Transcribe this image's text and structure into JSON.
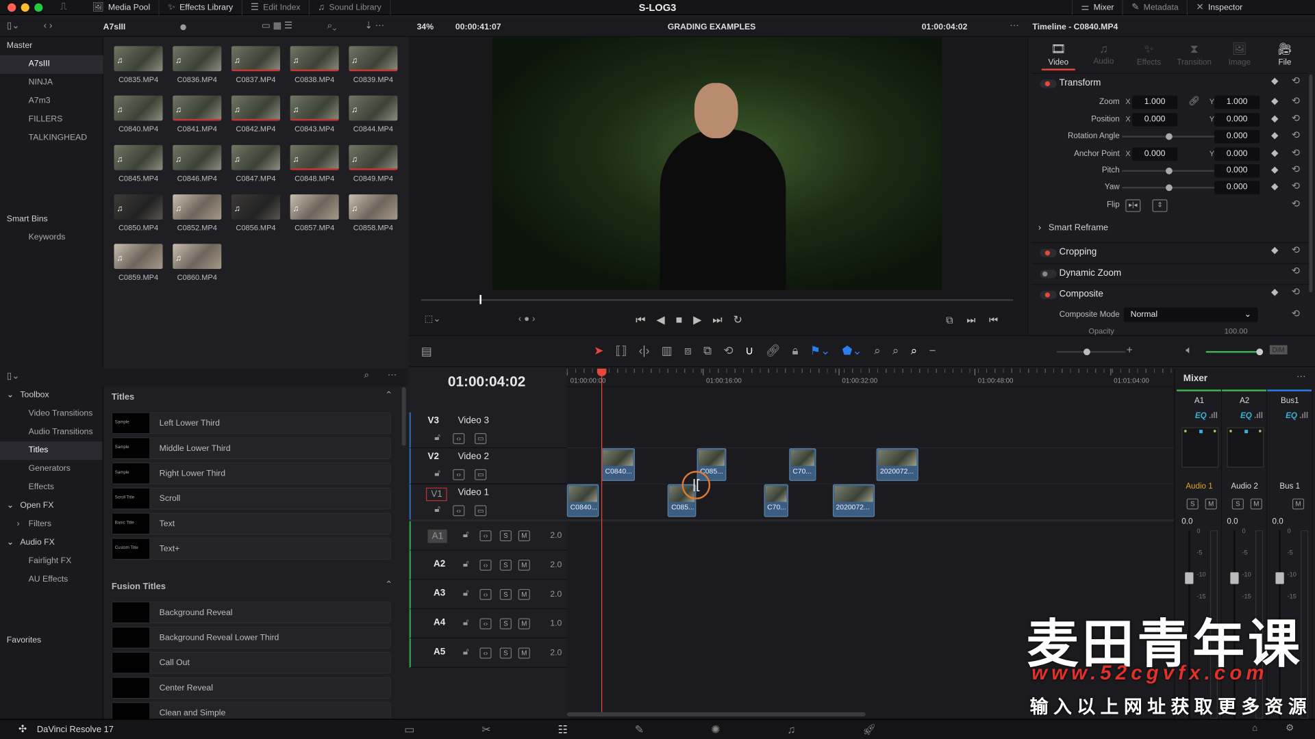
{
  "topbar": {
    "tabs": [
      {
        "label": "Media Pool",
        "icon": "media-pool-icon"
      },
      {
        "label": "Effects Library",
        "icon": "wand-icon"
      },
      {
        "label": "Edit Index",
        "icon": "list-icon"
      },
      {
        "label": "Sound Library",
        "icon": "music-list-icon"
      }
    ],
    "project_title": "S-LOG3",
    "right_tabs": [
      {
        "label": "Mixer",
        "icon": "sliders-icon"
      },
      {
        "label": "Metadata",
        "icon": "metadata-icon"
      },
      {
        "label": "Inspector",
        "icon": "inspector-icon"
      }
    ]
  },
  "subbar": {
    "bin_name": "A7sIII",
    "zoom": "34%",
    "source_timecode": "00:00:41:07",
    "timeline_name": "GRADING EXAMPLES",
    "record_timecode": "01:00:04:02",
    "inspector_title": "Timeline - C0840.MP4"
  },
  "bins": {
    "master": "Master",
    "items": [
      "A7sIII",
      "NINJA",
      "A7m3",
      "FILLERS",
      "TALKINGHEAD"
    ],
    "selected": "A7sIII",
    "smart_bins": "Smart Bins",
    "smart_items": [
      "Keywords"
    ]
  },
  "media_pool": {
    "clips": [
      "C0835.MP4",
      "C0836.MP4",
      "C0837.MP4",
      "C0838.MP4",
      "C0839.MP4",
      "C0840.MP4",
      "C0841.MP4",
      "C0842.MP4",
      "C0843.MP4",
      "C0844.MP4",
      "C0845.MP4",
      "C0846.MP4",
      "C0847.MP4",
      "C0848.MP4",
      "C0849.MP4",
      "C0850.MP4",
      "C0852.MP4",
      "C0856.MP4",
      "C0857.MP4",
      "C0858.MP4",
      "C0859.MP4",
      "C0860.MP4"
    ]
  },
  "effects": {
    "tree": [
      {
        "label": "Toolbox",
        "section": true
      },
      {
        "label": "Video Transitions"
      },
      {
        "label": "Audio Transitions"
      },
      {
        "label": "Titles",
        "selected": true
      },
      {
        "label": "Generators"
      },
      {
        "label": "Effects"
      },
      {
        "label": "Open FX",
        "section": true
      },
      {
        "label": "Filters",
        "sub": true
      },
      {
        "label": "Audio FX",
        "section": true
      },
      {
        "label": "Fairlight FX"
      },
      {
        "label": "AU Effects"
      }
    ],
    "favorites": "Favorites",
    "titles_header": "Titles",
    "titles": [
      {
        "name": "Left Lower Third",
        "thumb": "Sample"
      },
      {
        "name": "Middle Lower Third",
        "thumb": "Sample"
      },
      {
        "name": "Right Lower Third",
        "thumb": "Sample"
      },
      {
        "name": "Scroll",
        "thumb": "Scroll Title"
      },
      {
        "name": "Text",
        "thumb": "Basic Title"
      },
      {
        "name": "Text+",
        "thumb": "Custom Title"
      }
    ],
    "fusion_header": "Fusion Titles",
    "fusion": [
      {
        "name": "Background Reveal"
      },
      {
        "name": "Background Reveal Lower Third"
      },
      {
        "name": "Call Out"
      },
      {
        "name": "Center Reveal"
      },
      {
        "name": "Clean and Simple"
      }
    ]
  },
  "inspector": {
    "tabs": [
      {
        "label": "Video",
        "active": true
      },
      {
        "label": "Audio"
      },
      {
        "label": "Effects"
      },
      {
        "label": "Transition"
      },
      {
        "label": "Image"
      },
      {
        "label": "File"
      }
    ],
    "transform": "Transform",
    "zoom_label": "Zoom",
    "zoom_x": "1.000",
    "zoom_y": "1.000",
    "position_label": "Position",
    "position_x": "0.000",
    "position_y": "0.000",
    "rotation_label": "Rotation Angle",
    "rotation": "0.000",
    "anchor_label": "Anchor Point",
    "anchor_x": "0.000",
    "anchor_y": "0.000",
    "pitch_label": "Pitch",
    "pitch": "0.000",
    "yaw_label": "Yaw",
    "yaw": "0.000",
    "flip_label": "Flip",
    "x": "X",
    "y": "Y",
    "smart_reframe": "Smart Reframe",
    "cropping": "Cropping",
    "dynamic_zoom": "Dynamic Zoom",
    "composite": "Composite",
    "composite_mode_label": "Composite Mode",
    "composite_mode": "Normal",
    "opacity_label": "Opacity",
    "opacity": "100.00"
  },
  "timeline": {
    "timecode": "01:00:04:02",
    "ruler": [
      "01:00:00:00",
      "01:00:16:00",
      "01:00:32:00",
      "01:00:48:00",
      "01:01:04:00"
    ],
    "playhead_seconds": 4.1,
    "video_tracks": [
      {
        "id": "V3",
        "name": "Video 3"
      },
      {
        "id": "V2",
        "name": "Video 2"
      },
      {
        "id": "V1",
        "name": "Video 1"
      }
    ],
    "audio_tracks": [
      {
        "id": "A1",
        "level": "2.0"
      },
      {
        "id": "A2",
        "level": "2.0"
      },
      {
        "id": "A3",
        "level": "2.0"
      },
      {
        "id": "A4",
        "level": "1.0"
      },
      {
        "id": "A5",
        "level": "2.0"
      }
    ],
    "clips_v2": [
      {
        "name": "C0840...",
        "start": 4.1,
        "end": 8
      },
      {
        "name": "C085...",
        "start": 15.3,
        "end": 18.8
      },
      {
        "name": "C70...",
        "start": 26.2,
        "end": 29.3
      },
      {
        "name": "2020072...",
        "start": 36.5,
        "end": 41.4
      }
    ],
    "clips_v1": [
      {
        "name": "C0840...",
        "start": 0,
        "end": 3.8
      },
      {
        "name": "C085...",
        "start": 11.9,
        "end": 15.2
      },
      {
        "name": "C70...",
        "start": 23.2,
        "end": 26.1
      },
      {
        "name": "2020072...",
        "start": 31.3,
        "end": 36.3
      }
    ],
    "solo": "S",
    "mute": "M"
  },
  "mixer": {
    "title": "Mixer",
    "channels": [
      {
        "id": "A1",
        "name": "Audio 1",
        "level": "0.0",
        "active": true
      },
      {
        "id": "A2",
        "name": "Audio 2",
        "level": "0.0"
      },
      {
        "id": "Bus1",
        "name": "Bus 1",
        "level": "0.0"
      }
    ],
    "eq": "EQ",
    "scale": [
      "0",
      "-5",
      "-10",
      "-15"
    ]
  },
  "bottombar": {
    "app_name": "DaVinci Resolve 17"
  },
  "watermark": {
    "line1": "麦田青年课",
    "line2": "www.52cgvfx.com",
    "line3": "输入以上网址获取更多资源"
  },
  "colors": {
    "accent": "#e8473a",
    "clip": "#3b5d82",
    "eq": "#2fb5d6",
    "audio_active": "#e0a526"
  }
}
